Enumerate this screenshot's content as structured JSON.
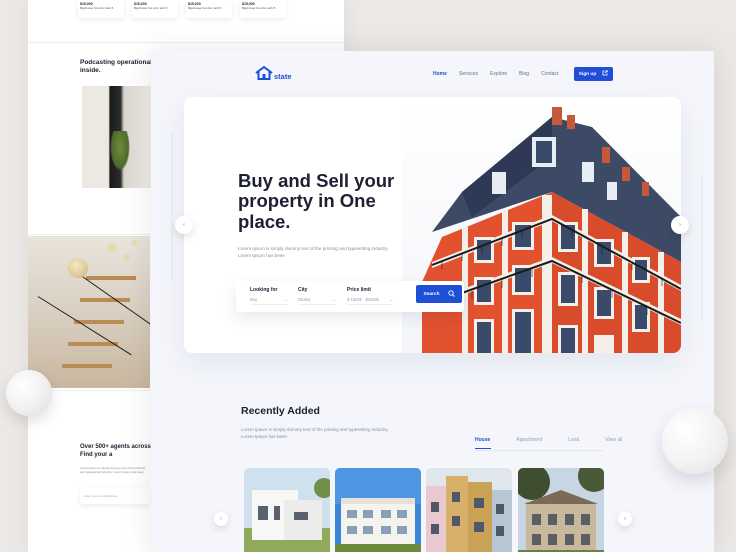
{
  "background_page": {
    "cards": [
      {
        "price": "$15,000",
        "details": "Bigdrower bui shor anb 5"
      },
      {
        "price": "$15,000",
        "details": "Bigdrower bui shor anb 5"
      },
      {
        "price": "$15,000",
        "details": "Bigdrower bui shor anb 5"
      },
      {
        "price": "$15,000",
        "details": "Bigdrower bui shor anb 5"
      }
    ],
    "podcast_title": "Podcasting operational management inside.",
    "agents_title": "Over 500+ agents across the country! Find your a",
    "agents_text": "Lorem Ipsum is simply dummy text of the printing and typesetting industry. Lorem Ipsum has been",
    "agents_input_placeholder": "Enter your email address"
  },
  "nav": {
    "logo_text": "state",
    "links": [
      "Home",
      "Services",
      "Explore",
      "Blog",
      "Contact"
    ],
    "active_link": "Home",
    "signup_label": "Sign up"
  },
  "hero": {
    "title": "Buy and Sell your property in One place.",
    "description": "Lorem Ipsum is simply dummy text of the printing and typesetting industry. Lorem Ipsum has been",
    "search": {
      "looking_for": {
        "label": "Looking for",
        "value": "Buy"
      },
      "city": {
        "label": "City",
        "value": "Dhaka"
      },
      "price_limit": {
        "label": "Price limit",
        "value": "$ 1500k - $2000k"
      },
      "button_label": "Search"
    }
  },
  "recently_added": {
    "title": "Recently Added",
    "description": "Lorem Ipsum is simply dummy text of the printing and typesetting industry. Lorem Ipsum has been",
    "tabs": [
      "House",
      "Appartment",
      "Land",
      "View all"
    ],
    "active_tab": "House"
  },
  "colors": {
    "accent": "#1e4fd6",
    "heading": "#1d1f33",
    "muted": "#8a8da0"
  },
  "icons": [
    "house-logo-icon",
    "external-link-icon",
    "search-icon",
    "chevron-left-icon",
    "chevron-right-icon",
    "chevron-down-icon"
  ]
}
